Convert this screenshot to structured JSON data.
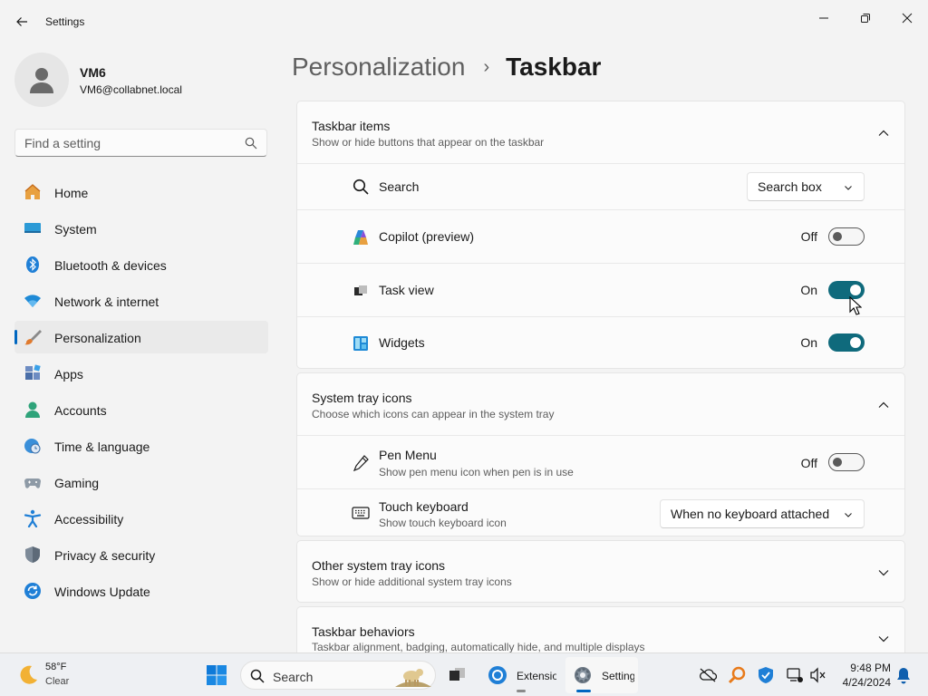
{
  "window": {
    "app_title": "Settings",
    "back_icon": "arrow-left-icon",
    "controls": [
      "minimize-icon",
      "restore-icon",
      "close-icon"
    ]
  },
  "user": {
    "name": "VM6",
    "email": "VM6@collabnet.local",
    "avatar_icon": "person-icon"
  },
  "search": {
    "placeholder": "Find a setting",
    "icon": "search-icon"
  },
  "sidebar": {
    "items": [
      {
        "label": "Home",
        "icon": "home-icon"
      },
      {
        "label": "System",
        "icon": "monitor-icon"
      },
      {
        "label": "Bluetooth & devices",
        "icon": "bluetooth-icon"
      },
      {
        "label": "Network & internet",
        "icon": "wifi-icon"
      },
      {
        "label": "Personalization",
        "icon": "brush-icon",
        "selected": true
      },
      {
        "label": "Apps",
        "icon": "apps-icon"
      },
      {
        "label": "Accounts",
        "icon": "accounts-icon"
      },
      {
        "label": "Time & language",
        "icon": "globe-clock-icon"
      },
      {
        "label": "Gaming",
        "icon": "gamepad-icon"
      },
      {
        "label": "Accessibility",
        "icon": "accessibility-icon"
      },
      {
        "label": "Privacy & security",
        "icon": "shield-icon"
      },
      {
        "label": "Windows Update",
        "icon": "update-icon"
      }
    ]
  },
  "breadcrumb": {
    "parent": "Personalization",
    "separator": "›",
    "current": "Taskbar"
  },
  "sections": {
    "taskbar_items": {
      "title": "Taskbar items",
      "subtitle": "Show or hide buttons that appear on the taskbar",
      "expanded": true,
      "rows": {
        "search": {
          "label": "Search",
          "icon": "search-icon",
          "value": "Search box"
        },
        "copilot": {
          "label": "Copilot (preview)",
          "icon": "copilot-icon",
          "state": "Off",
          "on": false
        },
        "task_view": {
          "label": "Task view",
          "icon": "task-view-icon",
          "state": "On",
          "on": true
        },
        "widgets": {
          "label": "Widgets",
          "icon": "widgets-icon",
          "state": "On",
          "on": true
        }
      }
    },
    "system_tray_icons": {
      "title": "System tray icons",
      "subtitle": "Choose which icons can appear in the system tray",
      "expanded": true,
      "rows": {
        "pen_menu": {
          "label": "Pen Menu",
          "sub": "Show pen menu icon when pen is in use",
          "icon": "pen-icon",
          "state": "Off",
          "on": false
        },
        "touch_keyboard": {
          "label": "Touch keyboard",
          "sub": "Show touch keyboard icon",
          "icon": "keyboard-icon",
          "value": "When no keyboard attached"
        }
      }
    },
    "other_tray_icons": {
      "title": "Other system tray icons",
      "subtitle": "Show or hide additional system tray icons",
      "expanded": false
    },
    "taskbar_behaviors": {
      "title": "Taskbar behaviors",
      "subtitle": "Taskbar alignment, badging, automatically hide, and multiple displays",
      "expanded": false
    }
  },
  "taskbar": {
    "weather": {
      "temp": "58°F",
      "desc": "Clear",
      "icon": "moon-icon"
    },
    "search_label": "Search",
    "apps": [
      {
        "label": "Extensio",
        "icon": "chrome-icon"
      },
      {
        "label": "Settings",
        "icon": "gear-icon",
        "active": true
      }
    ],
    "clock": {
      "time": "9:48 PM",
      "date": "4/24/2024"
    },
    "accent": "#0067c0"
  },
  "colors": {
    "toggle_on": "#0f6a7c",
    "accent": "#0067c0",
    "background": "#f3f3f3"
  }
}
